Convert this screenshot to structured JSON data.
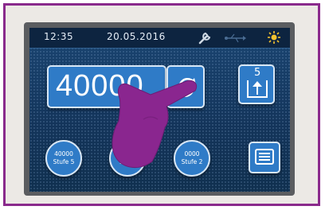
{
  "status_bar": {
    "time": "12:35",
    "date": "20.05.2016",
    "icons": [
      "wrench-icon",
      "usb-icon",
      "sun-icon"
    ]
  },
  "main": {
    "value_display": "40000",
    "rotate_button_icon": "rotate-arrows-icon",
    "level_button_icon": "level-up-icon",
    "level_button_number": "5",
    "menu_button_icon": "list-icon"
  },
  "presets": [
    {
      "value": "40000",
      "label": "Stufe 5"
    },
    {
      "value": "3",
      "label": "Stufe"
    },
    {
      "value": "0000",
      "label": "Stufe 2"
    }
  ],
  "colors": {
    "frame_border": "#8a2a8c",
    "button_blue": "#2f7bc7",
    "screen_bg": "#163a63",
    "hand": "#8a268f"
  }
}
